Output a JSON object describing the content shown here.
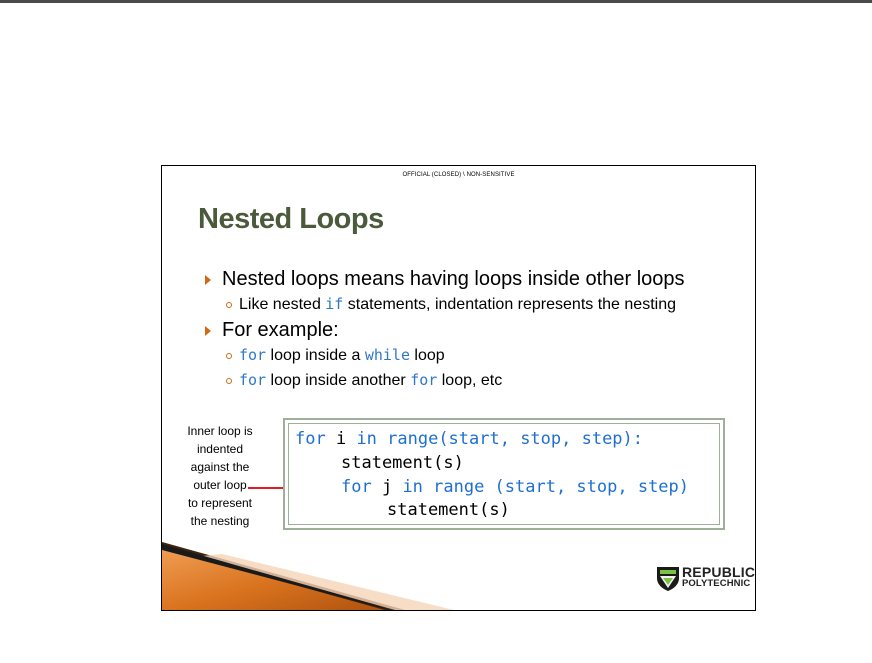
{
  "slide": {
    "classification": "OFFICIAL (CLOSED) \\ NON-SENSITIVE",
    "title": "Nested Loops",
    "bullet1": "Nested loops means having loops inside other loops",
    "sub1": {
      "pre": "Like nested ",
      "code": "if",
      "post": " statements, indentation represents the nesting"
    },
    "bullet2": "For example:",
    "sub2": {
      "code1": "for",
      "mid": " loop inside a ",
      "code2": "while",
      "post": " loop"
    },
    "sub3": {
      "code1": "for",
      "mid": " loop inside another ",
      "code2": "for",
      "post": " loop, etc"
    },
    "note": [
      "Inner loop is",
      "indented",
      "against the",
      "outer loop",
      "to represent",
      "the nesting"
    ],
    "code": {
      "line1_kw1": "for",
      "line1_var": " i ",
      "line1_kw2": "in range(start, stop, step):",
      "line2": "statement(s)",
      "line3_kw1": "for",
      "line3_var": " j ",
      "line3_kw2": "in range (start, stop, step)",
      "line4": "statement(s)"
    },
    "logo": {
      "line1": "REPUBLIC",
      "line2": "POLYTECHNIC"
    }
  },
  "colors": {
    "title": "#4b5a3b",
    "bullet_marker": "#d16a17",
    "code_keyword": "#1f6fd0",
    "arrow": "#e31b23",
    "code_border": "#9fb09a"
  }
}
